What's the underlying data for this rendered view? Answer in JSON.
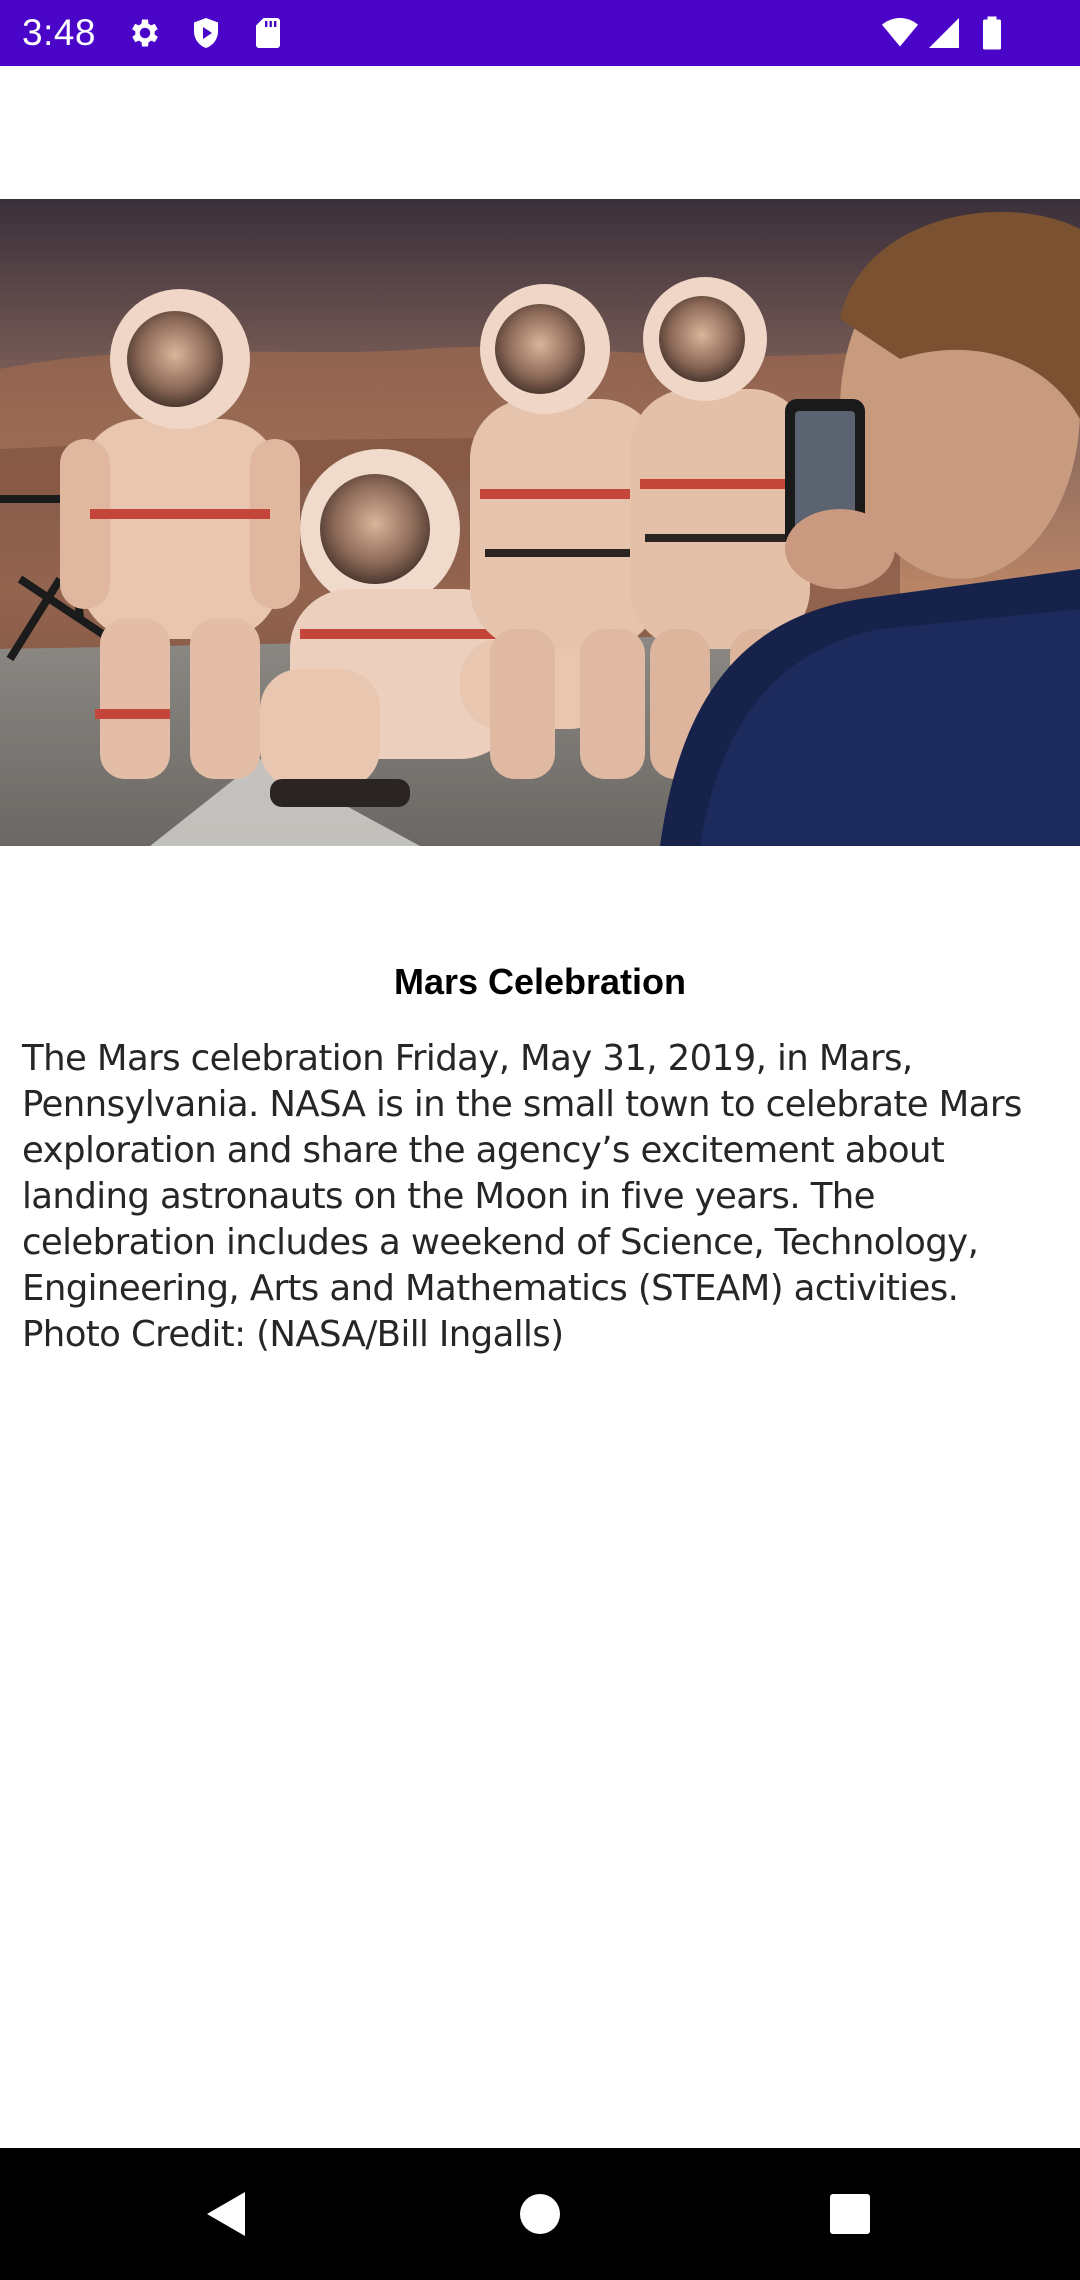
{
  "status_bar": {
    "time": "3:48",
    "background_color": "#4a05c9",
    "left_icons": [
      "settings-gear-icon",
      "shield-play-icon",
      "sd-card-icon"
    ],
    "right_icons": [
      "wifi-icon",
      "cell-signal-icon",
      "battery-icon"
    ]
  },
  "hero_image": {
    "subject": "people in Mars spacesuit cutouts being photographed with a phone"
  },
  "article": {
    "title": "Mars Celebration",
    "description": "The Mars celebration Friday, May 31, 2019, in Mars, Pennsylvania. NASA is in the small town to celebrate Mars exploration and share the agency’s excitement about landing astronauts on the Moon in five years. The celebration includes a weekend of Science, Technology, Engineering, Arts and Mathematics (STEAM) activities. Photo Credit: (NASA/Bill Ingalls)"
  },
  "nav_bar": {
    "buttons": [
      "back-icon",
      "home-icon",
      "recents-icon"
    ]
  }
}
